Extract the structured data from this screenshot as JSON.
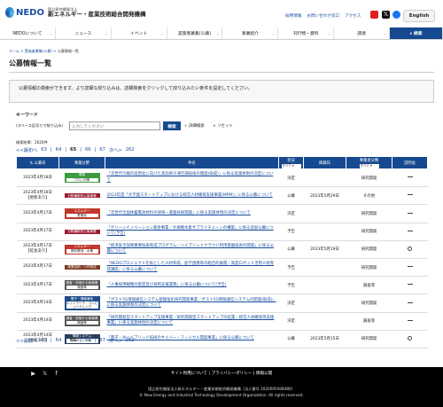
{
  "header": {
    "logo": "NEDO",
    "org_small": "国立研究開発法人",
    "org_name": "新エネルギー・産業技術総合開発機構",
    "links": [
      "採用情報",
      "お問い合わせ窓口",
      "アクセス"
    ],
    "english": "English"
  },
  "nav": [
    "NEDOについて",
    "ニュース",
    "イベント",
    "実施者募集(公募)",
    "事業紹介",
    "刊行物・資料",
    "調達"
  ],
  "nav_search": "検索",
  "breadcrumb": [
    "ホーム",
    "実施者募集(公募)",
    "公募情報一覧"
  ],
  "page_title": "公募情報一覧",
  "intro": "公募情報の検索ができます。より詳細な絞り込みは、詳細検索をクリックして絞り込みたい条件を設定してください。",
  "keyword": {
    "label": "キーワード",
    "sublabel": "(スペース区切りで絞り込み)",
    "placeholder": "入力してください",
    "button": "検索",
    "detail": "詳細検索",
    "reset": "リセット"
  },
  "result_count": "検索結果：2620件",
  "pager": {
    "first": "最初へ",
    "pages": [
      "63",
      "64",
      "65",
      "66",
      "67"
    ],
    "current": "65",
    "next": "次へ",
    "last": "262"
  },
  "table": {
    "headers": [
      "公募日",
      "事業分野",
      "件名",
      "状況",
      "掲載日",
      "事業者分類",
      "説明会"
    ],
    "filters": {
      "status": "すべて",
      "category": "すべて"
    },
    "rows": [
      {
        "date": "2023年4月18日",
        "updated": "",
        "badge": "環境",
        "badge_color": "#3c9a3f",
        "sub": "フロン対策",
        "title": "「次世代冷媒の実用化に向けた高効率冷凍空調技術の開発(助成)」に係る実施体制の決定について",
        "status": "決定",
        "posted": "",
        "cls": "研究開発",
        "brief": "dash"
      },
      {
        "date": "2023年4月18日",
        "updated": "【更新あり】",
        "badge": "分野横断的公募事業",
        "badge_color": "#9b1b30",
        "sub": "",
        "title": "2023年度「大学発スタートアップにおける経営人材確保支援事業(MPM)」に係る公募について",
        "status": "公募",
        "posted": "2023年5月29日",
        "cls": "その他",
        "brief": "dash"
      },
      {
        "date": "2023年4月17日",
        "updated": "",
        "badge": "エネルギー",
        "badge_color": "#c0392b",
        "sub": "蓄電池",
        "title": "「次世代全固体蓄電池材料の評価・基盤技術開発」に係る実施体制の決定について",
        "status": "決定",
        "posted": "",
        "cls": "研究開発",
        "brief": "dash"
      },
      {
        "date": "2023年4月17日",
        "updated": "",
        "badge": "分野横断的公募事業",
        "badge_color": "#9b1b30",
        "sub": "",
        "title": "「グリーンイノベーション基金事業／大規模水素サプライチェーンの構築」に係る追加公募について(予告)",
        "status": "予告",
        "posted": "",
        "cls": "研究開発",
        "brief": "dash"
      },
      {
        "date": "2023年4月17日",
        "updated": "【延長あり】",
        "badge": "エネルギー",
        "badge_color": "#c0392b",
        "sub": "燃料電池・水素",
        "title": "「経済安全保障重要技術育成プログラム／ハイブリッドクラウド利用基盤技術の開発」に係る公募について",
        "status": "公募",
        "posted": "2023年5月19日",
        "cls": "研究開発",
        "brief": "circle"
      },
      {
        "date": "2023年4月17日",
        "updated": "",
        "badge": "産業技術／人材育成",
        "badge_color": "#7b3a1f",
        "sub": "",
        "title": "「NEDOプロジェクトを核とした人材育成、産学連携等の総合的展開／高度ロボット活用人材育成講座」に係る公募について",
        "status": "予告",
        "posted": "",
        "cls": "研究開発",
        "brief": "dash"
      },
      {
        "date": "2023年4月17日",
        "updated": "",
        "badge": "調査・評価その他事業",
        "badge_color": "#555555",
        "sub": "調査等",
        "title": "「人事採用戦略の策定及び採用支援業務」に係る公募について(予告)",
        "status": "予告",
        "posted": "",
        "cls": "調査等",
        "brief": "dash"
      },
      {
        "date": "2023年4月14日",
        "updated": "",
        "badge": "電子・情報通信",
        "badge_color": "#1f4e8c",
        "sub": "ネットワーク・コンピューティング",
        "title": "「ポスト5G情報通信システム基盤強化研究開発事業／ポスト5G情報通信システムの開発(助成)」に係る実施体制の決定について",
        "status": "決定",
        "posted": "",
        "cls": "研究開発",
        "brief": "dash"
      },
      {
        "date": "2023年4月14日",
        "updated": "",
        "badge": "調査・評価その他事業",
        "badge_color": "#555555",
        "sub": "調査等",
        "title": "「研究開発型スタートアップ支援事業／研究開発型スタートアップの起業・経営人材確保等支援事業」に係る実施体制の決定について",
        "status": "決定",
        "posted": "",
        "cls": "調査等",
        "brief": "dash"
      },
      {
        "date": "2023年4月14日",
        "updated": "【更新あり】",
        "badge": "情報システム",
        "badge_color": "#2a3d5c",
        "sub": "ロボット・AI",
        "title": "「量子・AIハイブリッド技術のサイバー・フィジカル開発事業」に係る公募について",
        "status": "公募",
        "posted": "2023年5月15日",
        "cls": "研究開発",
        "brief": "circle"
      }
    ]
  },
  "footer": {
    "links": [
      "サイト利用について",
      "プライバシーポリシー",
      "情報公開"
    ],
    "org": "国立研究開発法人新エネルギー・産業技術総合開発機構（法人番号 2020005008480）",
    "copyright": "© New Energy and Industrial Technology Development Organization. All rights reserved."
  }
}
